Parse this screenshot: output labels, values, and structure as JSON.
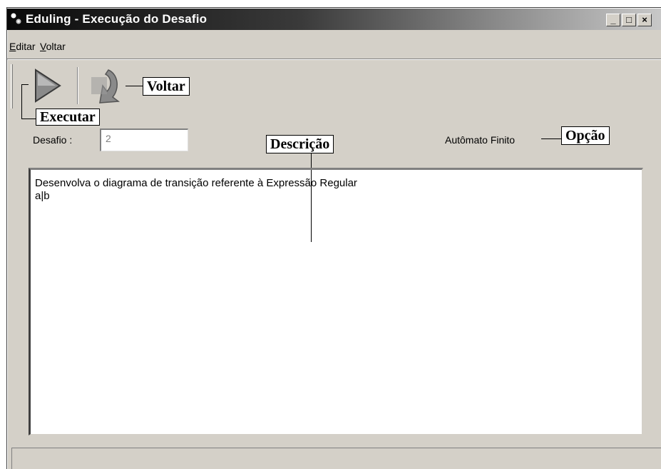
{
  "window": {
    "title": "Eduling - Execução do Desafio"
  },
  "title_buttons": {
    "minimize": "_",
    "maximize": "□",
    "close": "×"
  },
  "menu": [
    {
      "underline": "E",
      "rest": "ditar"
    },
    {
      "underline": "V",
      "rest": "oltar"
    }
  ],
  "toolbar": {
    "execute_icon": "play-icon",
    "back_icon": "back-arrow-icon"
  },
  "callouts": {
    "voltar": "Voltar",
    "executar": "Executar",
    "descricao": "Descrição",
    "opcao": "Opção"
  },
  "form": {
    "desafio_label": "Desafio :",
    "desafio_value": "2",
    "option_text": "Autômato Finito"
  },
  "description": {
    "line1": "Desenvolva o diagrama de transição referente à Expressão Regular",
    "line2": "a|b"
  }
}
